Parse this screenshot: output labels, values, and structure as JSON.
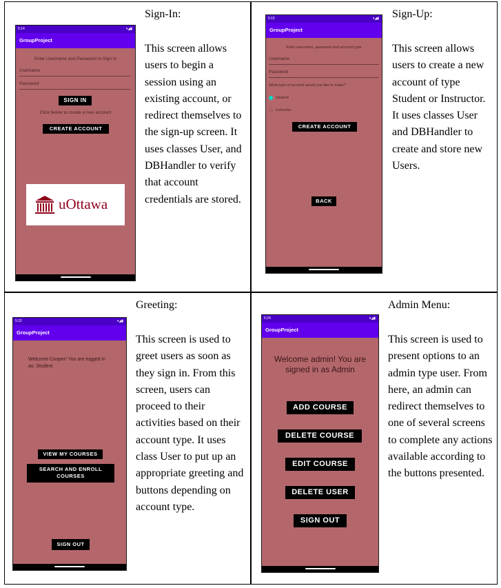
{
  "cells": {
    "signin": {
      "title": "Sign-In:",
      "body": "This screen allows users to begin a session using an existing account, or redirect themselves to the sign-up screen. It uses classes User, and DBHandler to verify that account credentials are stored.",
      "phone": {
        "time": "5:14",
        "app_title": "GroupProject",
        "prompt": "Enter Username and Password to Sign In",
        "username_placeholder": "Username",
        "password_placeholder": "Password",
        "sign_in_label": "SIGN IN",
        "create_hint": "Click below to create a new account",
        "create_label": "CREATE ACCOUNT",
        "logo_text": "uOttawa"
      }
    },
    "signup": {
      "title": "Sign-Up:",
      "body": "This screen allows users to create a new account of type Student or Instructor. It uses classes User and DBHandler to create and store new Users.",
      "phone": {
        "time": "5:15",
        "app_title": "GroupProject",
        "prompt": "Enter username, password and account type",
        "username_placeholder": "Username",
        "password_placeholder": "Password",
        "question": "What type of account would you like to make?",
        "option_student": "Student",
        "option_instructor": "Instructor",
        "create_label": "CREATE ACCOUNT",
        "back_label": "BACK"
      }
    },
    "greeting": {
      "title": "Greeting:",
      "body": "This screen is used to greet users as soon as they sign in. From this screen, users can proceed to their activities based on their account type. It uses class User to put up an appropriate greeting and buttons depending on account type.",
      "phone": {
        "time": "5:22",
        "app_title": "GroupProject",
        "welcome": "Welcome Cooper! You are logged in as: Student",
        "view_label": "VIEW MY COURSES",
        "search_label": "SEARCH AND ENROLL COURSES",
        "signout_label": "SIGN OUT"
      }
    },
    "admin": {
      "title": "Admin Menu:",
      "body": "This screen is used to present options to an admin type user. From here, an admin can redirect themselves to one of several screens to complete any actions available according to the buttons presented.",
      "phone": {
        "time": "5:24",
        "app_title": "GroupProject",
        "welcome": "Welcome admin! You are signed in as Admin",
        "add_label": "ADD COURSE",
        "delete_course_label": "DELETE COURSE",
        "edit_label": "EDIT COURSE",
        "delete_user_label": "DELETE USER",
        "signout_label": "SIGN OUT"
      }
    }
  },
  "colors": {
    "status_bar": "#4a00c6",
    "app_bar": "#6200ee",
    "screen_bg": "#b4676b",
    "button": "#000000",
    "radio_selected": "#03dac5"
  }
}
